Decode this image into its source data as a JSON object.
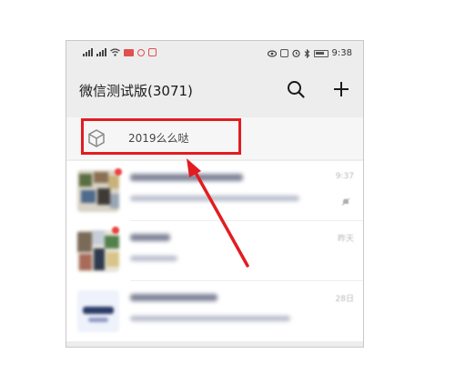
{
  "status_bar": {
    "time": "9:38",
    "left_icons": [
      "signal-icon",
      "signal-icon",
      "wifi-icon",
      "notification-badge",
      "notification-badge"
    ],
    "right_icons": [
      "eye-icon",
      "nfc-icon",
      "alarm-icon",
      "bluetooth-icon",
      "battery-icon"
    ]
  },
  "header": {
    "title": "微信测试版(3071)",
    "actions": [
      "search-icon",
      "add-icon"
    ]
  },
  "mini_program_bar": {
    "icon": "box-icon",
    "label": "2019么么哒"
  },
  "chats": [
    {
      "time": "9:37",
      "muted": true,
      "unread": true
    },
    {
      "time": "昨天",
      "muted": false,
      "unread": true
    },
    {
      "time": "28日",
      "muted": false,
      "unread": false
    }
  ],
  "annotation": {
    "color": "#e11d22"
  }
}
